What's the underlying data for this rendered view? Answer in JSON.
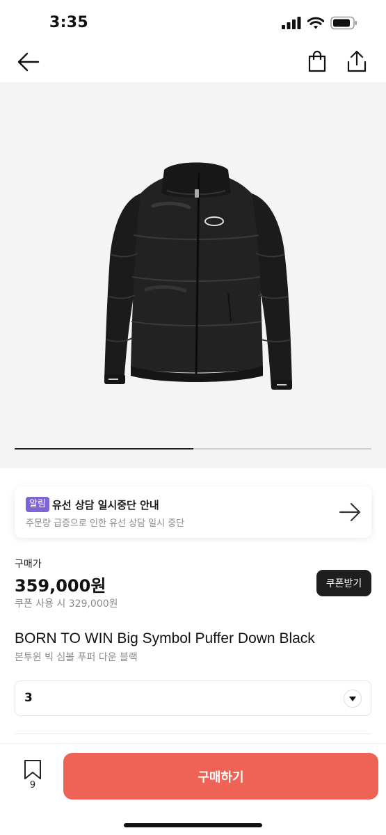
{
  "status_bar": {
    "time": "3:35"
  },
  "nav": {
    "back_icon": "arrow-left-icon",
    "bag_icon": "shopping-bag-icon",
    "share_icon": "share-icon"
  },
  "gallery": {
    "image": "black puffer down jacket",
    "progress_fraction": 0.5
  },
  "notice": {
    "badge": "알림",
    "title": "유선 상담 일시중단 안내",
    "subtitle": "주문량 급증으로 인한 유선 상담 일시 중단"
  },
  "price": {
    "label": "구매가",
    "value": "359,000원",
    "coupon_price": "쿠폰 사용 시 329,000원",
    "coupon_button": "쿠폰받기"
  },
  "product": {
    "name": "BORN TO WIN Big Symbol Puffer Down Black",
    "name_ko": "본투윈 빅 심볼 푸퍼 다운 블랙"
  },
  "option": {
    "selected": "3"
  },
  "bottom_bar": {
    "bookmark_count": "9",
    "buy_label": "구매하기"
  },
  "colors": {
    "accent": "#ee6355",
    "badge": "#7f64d3",
    "coupon_button": "#1e1e1e"
  }
}
